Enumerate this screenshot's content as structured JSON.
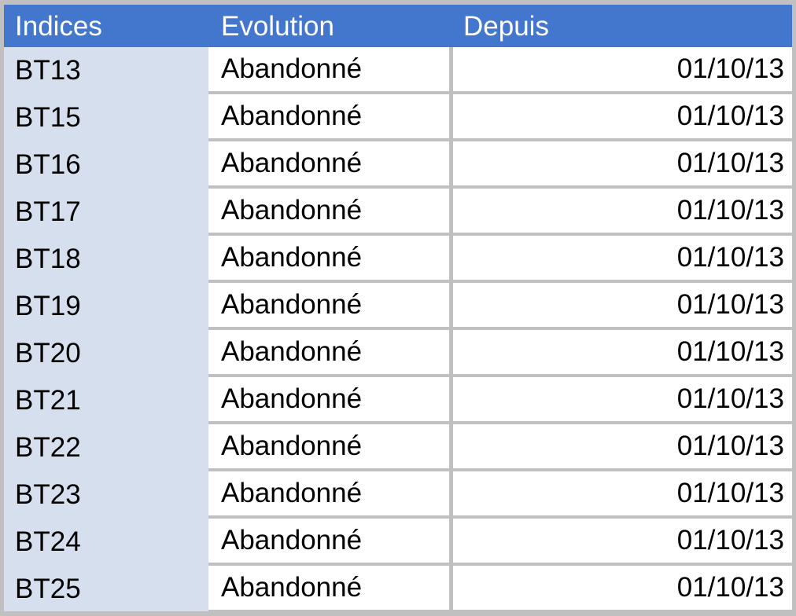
{
  "table": {
    "columns": [
      {
        "key": "indices",
        "label": "Indices",
        "align": "left"
      },
      {
        "key": "evolution",
        "label": "Evolution",
        "align": "left"
      },
      {
        "key": "depuis",
        "label": "Depuis",
        "align": "right"
      }
    ],
    "rows": [
      {
        "indices": "BT13",
        "evolution": "Abandonné",
        "depuis": "01/10/13"
      },
      {
        "indices": "BT15",
        "evolution": "Abandonné",
        "depuis": "01/10/13"
      },
      {
        "indices": "BT16",
        "evolution": "Abandonné",
        "depuis": "01/10/13"
      },
      {
        "indices": "BT17",
        "evolution": "Abandonné",
        "depuis": "01/10/13"
      },
      {
        "indices": "BT18",
        "evolution": "Abandonné",
        "depuis": "01/10/13"
      },
      {
        "indices": "BT19",
        "evolution": "Abandonné",
        "depuis": "01/10/13"
      },
      {
        "indices": "BT20",
        "evolution": "Abandonné",
        "depuis": "01/10/13"
      },
      {
        "indices": "BT21",
        "evolution": "Abandonné",
        "depuis": "01/10/13"
      },
      {
        "indices": "BT22",
        "evolution": "Abandonné",
        "depuis": "01/10/13"
      },
      {
        "indices": "BT23",
        "evolution": "Abandonné",
        "depuis": "01/10/13"
      },
      {
        "indices": "BT24",
        "evolution": "Abandonné",
        "depuis": "01/10/13"
      },
      {
        "indices": "BT25",
        "evolution": "Abandonné",
        "depuis": "01/10/13"
      }
    ]
  },
  "colors": {
    "header_background": "#4277cd",
    "header_text": "#ffffff",
    "index_column_background": "#d5dfee",
    "cell_background": "#ffffff",
    "grid_line": "#c0c0c0",
    "body_text": "#000000"
  }
}
